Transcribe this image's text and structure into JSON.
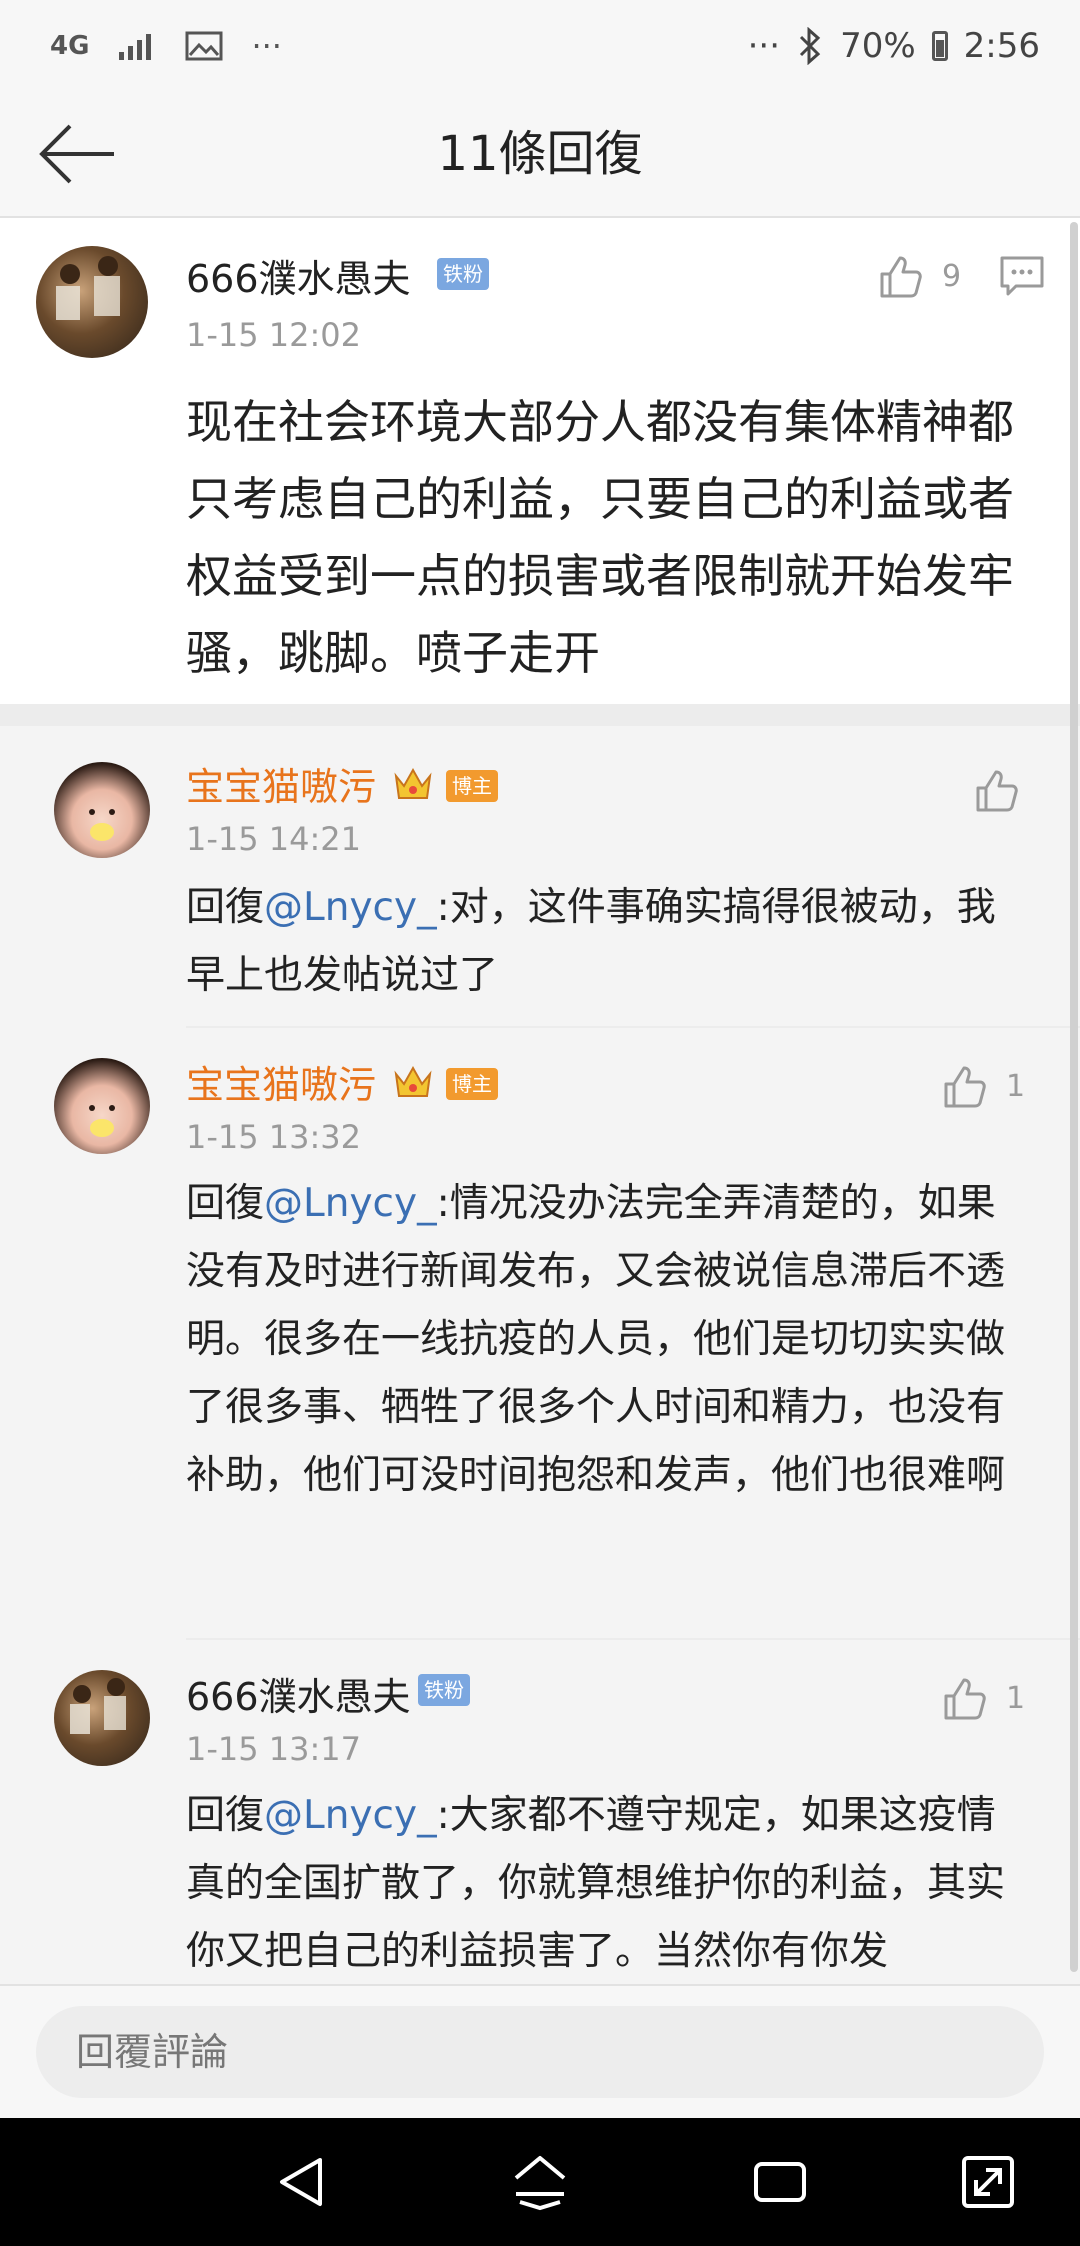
{
  "status_bar": {
    "network": "4G",
    "more": "···",
    "more_right": "···",
    "battery": "70%",
    "time": "2:56"
  },
  "header": {
    "title": "11條回復"
  },
  "main_comment": {
    "user": "666濮水愚夫",
    "badge": "铁粉",
    "time": "1-15 12:02",
    "likes": "9",
    "text": "现在社会环境大部分人都没有集体精神都只考虑自己的利益，只要自己的利益或者权益受到一点的损害或者限制就开始发牢骚，跳脚。喷子走开"
  },
  "replies": [
    {
      "user": "宝宝猫嗷污",
      "badge": "博主",
      "time": "1-15 14:21",
      "likes": "",
      "prefix": "回復",
      "mention": "@Lnycy_",
      "text": ":对，这件事确实搞得很被动，我早上也发帖说过了"
    },
    {
      "user": "宝宝猫嗷污",
      "badge": "博主",
      "time": "1-15 13:32",
      "likes": "1",
      "prefix": "回復",
      "mention": "@Lnycy_",
      "text": ":情况没办法完全弄清楚的，如果没有及时进行新闻发布，又会被说信息滞后不透明。很多在一线抗疫的人员，他们是切切实实做了很多事、牺牲了很多个人时间和精力，也没有补助，他们可没时间抱怨和发声，他们也很难啊"
    },
    {
      "user": "666濮水愚夫",
      "badge": "铁粉",
      "time": "1-15 13:17",
      "likes": "1",
      "prefix": "回復",
      "mention": "@Lnycy_",
      "text": ":大家都不遵守规定，如果这疫情真的全国扩散了，你就算想维护你的利益，其实你又把自己的利益损害了。当然你有你发"
    }
  ],
  "composer": {
    "placeholder": "回覆評論"
  },
  "colors": {
    "accent_orange": "#e8741c",
    "fan_badge": "#7ba7e0",
    "blogger_badge": "#f29a2e",
    "mention": "#3b6fb3",
    "meta_gray": "#9a9a9a"
  },
  "icons": [
    "back-arrow-icon",
    "thumb-up-icon",
    "comment-icon",
    "crown-icon",
    "bluetooth-icon",
    "signal-icon",
    "image-icon",
    "battery-icon",
    "nav-back-icon",
    "nav-home-icon",
    "nav-recents-icon",
    "nav-expand-icon"
  ]
}
